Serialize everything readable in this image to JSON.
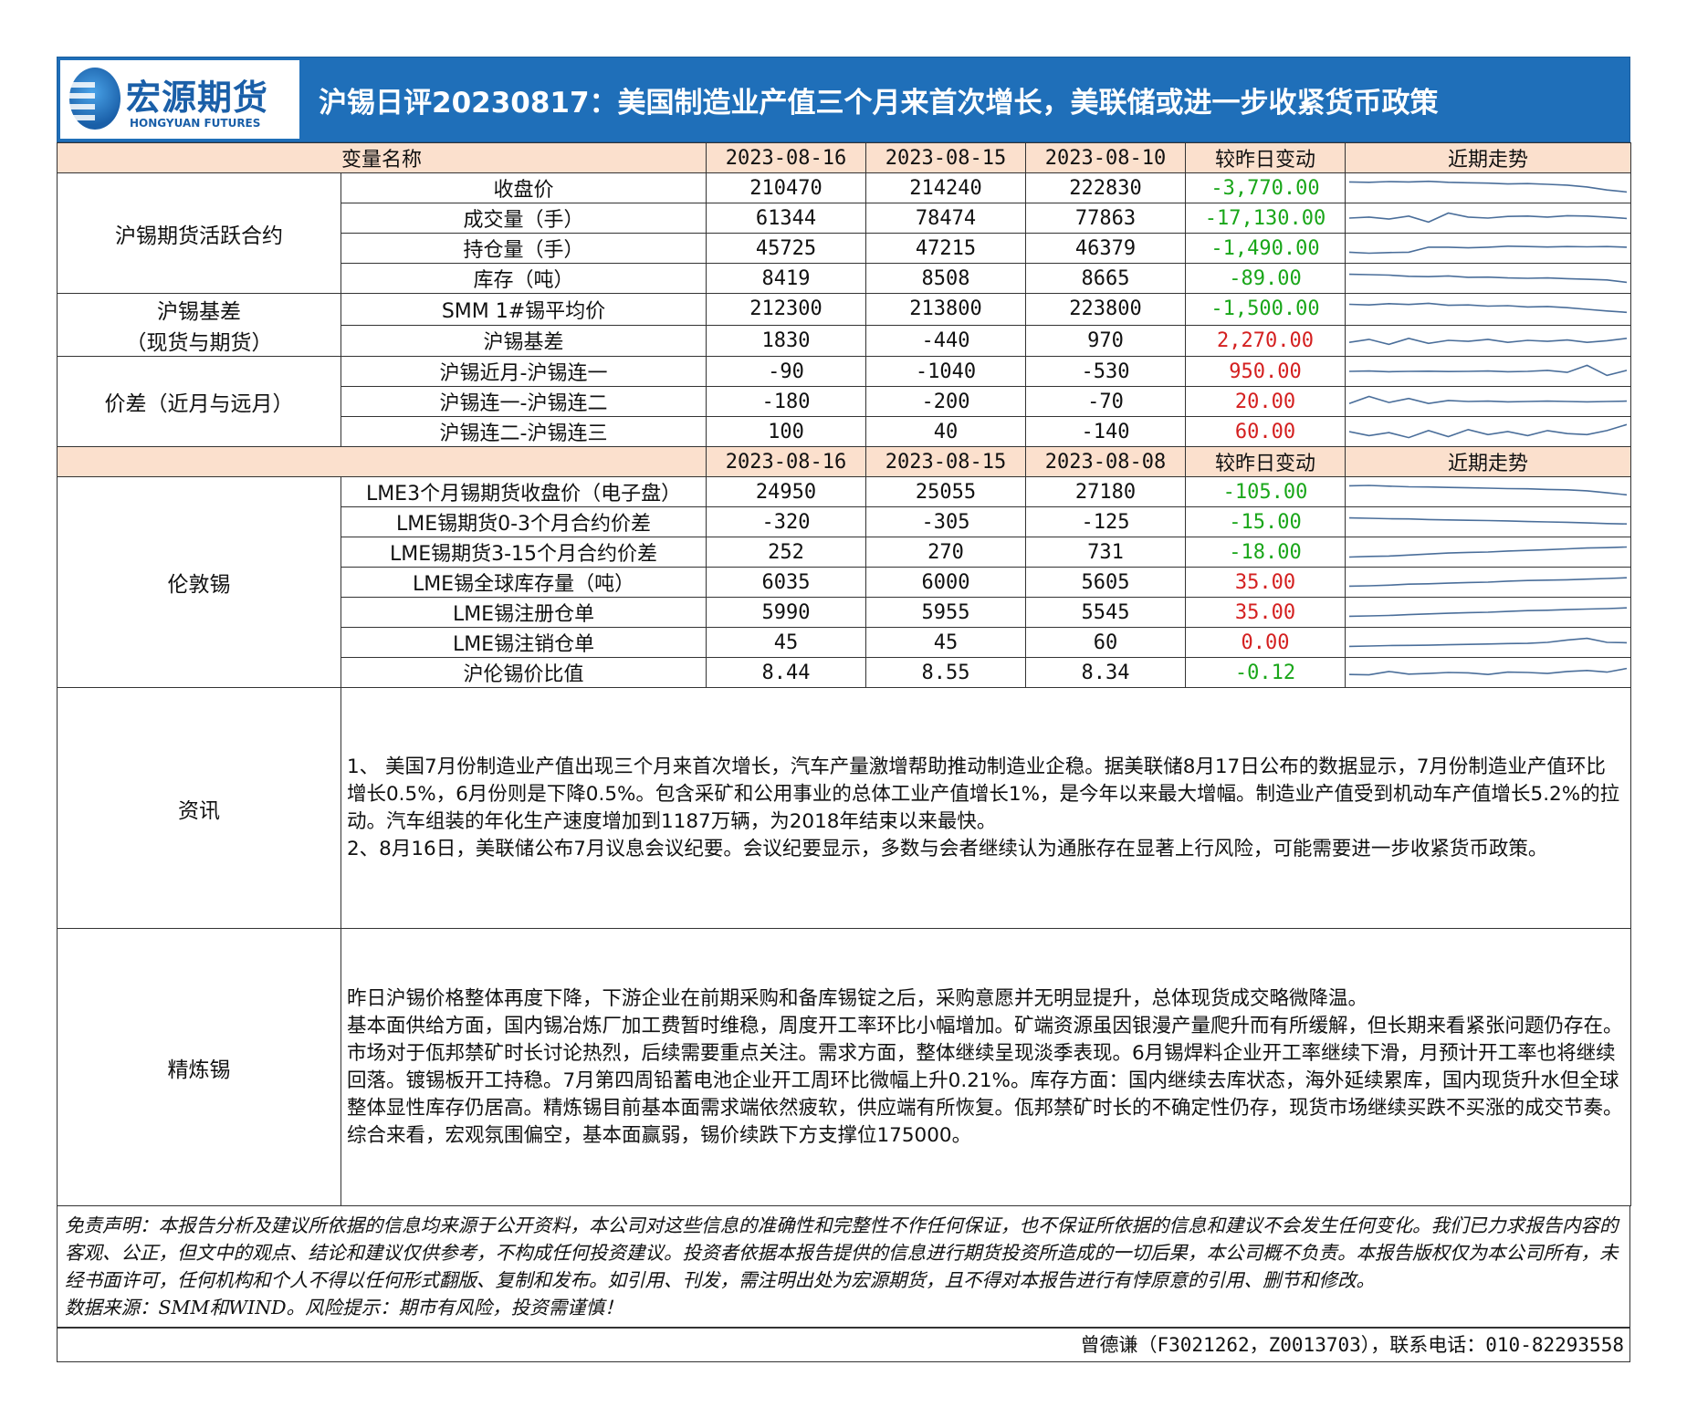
{
  "header": {
    "logo_cn": "宏源期货",
    "logo_en": "HONGYUAN FUTURES",
    "title": "沪锡日评20230817：美国制造业产值三个月来首次增长，美联储或进一步收紧货币政策"
  },
  "table1": {
    "headers": [
      "变量名称",
      "2023-08-16",
      "2023-08-15",
      "2023-08-10",
      "较昨日变动",
      "近期走势"
    ],
    "groups": [
      {
        "category": "沪锡期货活跃合约",
        "rows": [
          {
            "name": "收盘价",
            "v1": "210470",
            "v2": "214240",
            "v3": "222830",
            "chg": "-3,770.00",
            "trend": [
              0.8,
              0.78,
              0.82,
              0.8,
              0.83,
              0.78,
              0.76,
              0.74,
              0.7,
              0.72,
              0.68,
              0.64,
              0.55,
              0.4,
              0.3
            ]
          },
          {
            "name": "成交量（手）",
            "v1": "61344",
            "v2": "78474",
            "v3": "77863",
            "chg": "-17,130.00",
            "trend": [
              0.5,
              0.55,
              0.45,
              0.6,
              0.3,
              0.75,
              0.55,
              0.5,
              0.58,
              0.6,
              0.55,
              0.62,
              0.6,
              0.55,
              0.48
            ]
          },
          {
            "name": "持仓量（手）",
            "v1": "45725",
            "v2": "47215",
            "v3": "46379",
            "chg": "-1,490.00",
            "trend": [
              0.3,
              0.25,
              0.28,
              0.3,
              0.55,
              0.55,
              0.52,
              0.55,
              0.6,
              0.58,
              0.56,
              0.58,
              0.57,
              0.58,
              0.55
            ]
          },
          {
            "name": "库存（吨）",
            "v1": "8419",
            "v2": "8508",
            "v3": "8665",
            "chg": "-89.00",
            "trend": [
              0.7,
              0.68,
              0.66,
              0.6,
              0.58,
              0.62,
              0.55,
              0.56,
              0.52,
              0.5,
              0.52,
              0.48,
              0.45,
              0.42,
              0.3
            ]
          }
        ]
      },
      {
        "category": "沪锡基差（现货与期货）",
        "rows": [
          {
            "name": "SMM 1#锡平均价",
            "v1": "212300",
            "v2": "213800",
            "v3": "223800",
            "chg": "-1,500.00",
            "trend": [
              0.75,
              0.72,
              0.78,
              0.74,
              0.8,
              0.7,
              0.72,
              0.66,
              0.68,
              0.62,
              0.64,
              0.58,
              0.5,
              0.42,
              0.35
            ]
          },
          {
            "name": "沪锡基差",
            "v1": "1830",
            "v2": "-440",
            "v3": "970",
            "chg": "2,270.00",
            "trend": [
              0.4,
              0.55,
              0.3,
              0.6,
              0.35,
              0.5,
              0.45,
              0.55,
              0.4,
              0.5,
              0.45,
              0.52,
              0.4,
              0.48,
              0.6
            ]
          }
        ]
      },
      {
        "category": "价差（近月与远月）",
        "rows": [
          {
            "name": "沪锡近月-沪锡连一",
            "v1": "-90",
            "v2": "-1040",
            "v3": "-530",
            "chg": "950.00",
            "trend": [
              0.5,
              0.52,
              0.48,
              0.5,
              0.51,
              0.49,
              0.5,
              0.52,
              0.48,
              0.5,
              0.55,
              0.45,
              0.8,
              0.3,
              0.55
            ]
          },
          {
            "name": "沪锡连一-沪锡连二",
            "v1": "-180",
            "v2": "-200",
            "v3": "-70",
            "chg": "20.00",
            "trend": [
              0.4,
              0.75,
              0.45,
              0.65,
              0.4,
              0.55,
              0.5,
              0.52,
              0.48,
              0.5,
              0.52,
              0.5,
              0.48,
              0.5,
              0.52
            ]
          },
          {
            "name": "沪锡连二-沪锡连三",
            "v1": "100",
            "v2": "40",
            "v3": "-140",
            "chg": "60.00",
            "trend": [
              0.5,
              0.3,
              0.45,
              0.2,
              0.55,
              0.25,
              0.6,
              0.35,
              0.5,
              0.3,
              0.55,
              0.4,
              0.35,
              0.55,
              0.85
            ]
          }
        ]
      }
    ]
  },
  "table2": {
    "headers": [
      "",
      "2023-08-16",
      "2023-08-15",
      "2023-08-08",
      "较昨日变动",
      "近期走势"
    ],
    "category": "伦敦锡",
    "rows": [
      {
        "name": "LME3个月锡期货收盘价（电子盘）",
        "v1": "24950",
        "v2": "25055",
        "v3": "27180",
        "chg": "-105.00",
        "trend": [
          0.8,
          0.82,
          0.78,
          0.75,
          0.74,
          0.72,
          0.7,
          0.68,
          0.66,
          0.65,
          0.62,
          0.6,
          0.55,
          0.45,
          0.35
        ]
      },
      {
        "name": "LME锡期货0-3个月合约价差",
        "v1": "-320",
        "v2": "-305",
        "v3": "-125",
        "chg": "-15.00",
        "trend": [
          0.7,
          0.68,
          0.66,
          0.65,
          0.62,
          0.6,
          0.58,
          0.57,
          0.55,
          0.52,
          0.5,
          0.48,
          0.45,
          0.42,
          0.4
        ]
      },
      {
        "name": "LME锡期货3-15个月合约价差",
        "v1": "252",
        "v2": "270",
        "v3": "731",
        "chg": "-18.00",
        "trend": [
          0.25,
          0.28,
          0.3,
          0.35,
          0.4,
          0.45,
          0.48,
          0.5,
          0.55,
          0.58,
          0.62,
          0.66,
          0.7,
          0.72,
          0.75
        ]
      },
      {
        "name": "LME锡全球库存量（吨）",
        "v1": "6035",
        "v2": "6000",
        "v3": "5605",
        "chg": "35.00",
        "trend": [
          0.3,
          0.32,
          0.35,
          0.4,
          0.42,
          0.45,
          0.48,
          0.5,
          0.55,
          0.58,
          0.6,
          0.62,
          0.65,
          0.68,
          0.72
        ]
      },
      {
        "name": "LME锡注册仓单",
        "v1": "5990",
        "v2": "5955",
        "v3": "5545",
        "chg": "35.00",
        "trend": [
          0.3,
          0.32,
          0.34,
          0.38,
          0.42,
          0.45,
          0.48,
          0.5,
          0.54,
          0.58,
          0.6,
          0.63,
          0.66,
          0.68,
          0.72
        ]
      },
      {
        "name": "LME锡注销仓单",
        "v1": "45",
        "v2": "45",
        "v3": "60",
        "chg": "0.00",
        "trend": [
          0.3,
          0.32,
          0.34,
          0.35,
          0.36,
          0.38,
          0.4,
          0.42,
          0.44,
          0.45,
          0.5,
          0.62,
          0.7,
          0.5,
          0.48
        ]
      },
      {
        "name": "沪伦锡价比值",
        "v1": "8.44",
        "v2": "8.55",
        "v3": "8.34",
        "chg": "-0.12",
        "trend": [
          0.4,
          0.38,
          0.55,
          0.42,
          0.45,
          0.5,
          0.48,
          0.4,
          0.52,
          0.5,
          0.45,
          0.55,
          0.6,
          0.52,
          0.7
        ]
      }
    ]
  },
  "news": {
    "label": "资讯",
    "paragraphs": [
      "1、 美国7月份制造业产值出现三个月来首次增长，汽车产量激增帮助推动制造业企稳。据美联储8月17日公布的数据显示，7月份制造业产值环比增长0.5%，6月份则是下降0.5%。包含采矿和公用事业的总体工业产值增长1%，是今年以来最大增幅。制造业产值受到机动车产值增长5.2%的拉动。汽车组装的年化生产速度增加到1187万辆，为2018年结束以来最快。",
      "2、8月16日，美联储公布7月议息会议纪要。会议纪要显示，多数与会者继续认为通胀存在显著上行风险，可能需要进一步收紧货币政策。"
    ]
  },
  "refined": {
    "label": "精炼锡",
    "paragraphs": [
      "昨日沪锡价格整体再度下降，下游企业在前期采购和备库锡锭之后，采购意愿并无明显提升，总体现货成交略微降温。",
      "基本面供给方面，国内锡冶炼厂加工费暂时维稳，周度开工率环比小幅增加。矿端资源虽因银漫产量爬升而有所缓解，但长期来看紧张问题仍存在。市场对于佤邦禁矿时长讨论热烈，后续需要重点关注。需求方面，整体继续呈现淡季表现。6月锡焊料企业开工率继续下滑，月预计开工率也将继续回落。镀锡板开工持稳。7月第四周铅蓄电池企业开工周环比微幅上升0.21%。库存方面：国内继续去库状态，海外延续累库，国内现货升水但全球整体显性库存仍居高。精炼锡目前基本面需求端依然疲软，供应端有所恢复。佤邦禁矿时长的不确定性仍存，现货市场继续买跌不买涨的成交节奏。综合来看，宏观氛围偏空，基本面赢弱，锡价续跌下方支撑位175000。"
    ]
  },
  "disclaimer": {
    "text": "免责声明：本报告分析及建议所依据的信息均来源于公开资料，本公司对这些信息的准确性和完整性不作任何保证，也不保证所依据的信息和建议不会发生任何变化。我们已力求报告内容的客观、公正，但文中的观点、结论和建议仅供参考，不构成任何投资建议。投资者依据本报告提供的信息进行期货投资所造成的一切后果，本公司概不负责。本报告版权仅为本公司所有，未经书面许可，任何机构和个人不得以任何形式翻版、复制和发布。如引用、刊发，需注明出处为宏源期货，且不得对本报告进行有悖原意的引用、删节和修改。",
    "source": "数据来源：SMM和WIND。风险提示：期市有风险，投资需谨慎！"
  },
  "contact": "曾德谦（F3021262，Z0013703），联系电话：010-82293558",
  "colors": {
    "banner": "#1f6fb9",
    "header_row": "#fbe0cd",
    "negative": "#19a619",
    "positive": "#d42020",
    "sparkline": "#4a6e9a"
  }
}
